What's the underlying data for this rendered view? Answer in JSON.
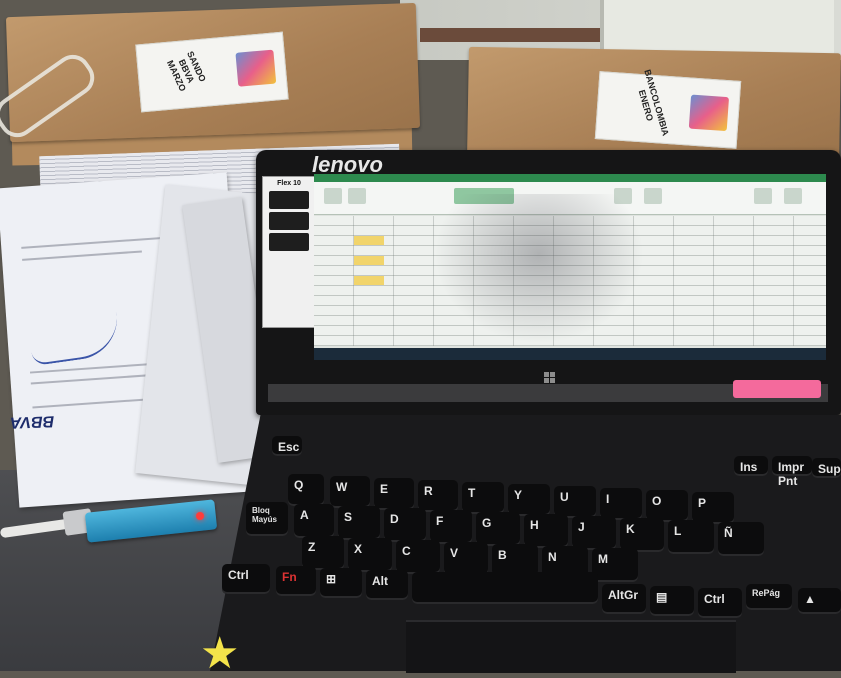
{
  "scene": {
    "description_visible_text": true
  },
  "folders": {
    "left_sticker": "SANDO\nBBVA\nMARZO",
    "right_sticker": "BANCOLOMBIA\nENERO"
  },
  "documents": {
    "bank_logo": "BBVA"
  },
  "laptop": {
    "brand": "lenovo",
    "spec_model": "Flex 10"
  },
  "keyboard": {
    "keys": [
      {
        "label": "Esc",
        "row": 0
      },
      {
        "label": "Supr",
        "row": 0
      },
      {
        "label": "Impr Pnt",
        "row": 0
      },
      {
        "label": "Ins",
        "row": 0
      },
      {
        "label": "Q",
        "row": 2
      },
      {
        "label": "W",
        "row": 2
      },
      {
        "label": "E",
        "row": 2
      },
      {
        "label": "R",
        "row": 2
      },
      {
        "label": "T",
        "row": 2
      },
      {
        "label": "Y",
        "row": 2
      },
      {
        "label": "U",
        "row": 2
      },
      {
        "label": "I",
        "row": 2
      },
      {
        "label": "O",
        "row": 2
      },
      {
        "label": "P",
        "row": 2
      },
      {
        "label": "A",
        "row": 3
      },
      {
        "label": "S",
        "row": 3
      },
      {
        "label": "D",
        "row": 3
      },
      {
        "label": "F",
        "row": 3
      },
      {
        "label": "G",
        "row": 3
      },
      {
        "label": "H",
        "row": 3
      },
      {
        "label": "J",
        "row": 3
      },
      {
        "label": "K",
        "row": 3
      },
      {
        "label": "L",
        "row": 3
      },
      {
        "label": "Ñ",
        "row": 3
      },
      {
        "label": "Z",
        "row": 4
      },
      {
        "label": "X",
        "row": 4
      },
      {
        "label": "C",
        "row": 4
      },
      {
        "label": "V",
        "row": 4
      },
      {
        "label": "B",
        "row": 4
      },
      {
        "label": "N",
        "row": 4
      },
      {
        "label": "M",
        "row": 4
      }
    ],
    "ctrl": "Ctrl",
    "fn": "Fn",
    "alt": "Alt",
    "altgr": "AltGr",
    "ctrl_right": "Ctrl",
    "repag": "RePág",
    "bloq_mayus": "Bloq Mayús"
  }
}
